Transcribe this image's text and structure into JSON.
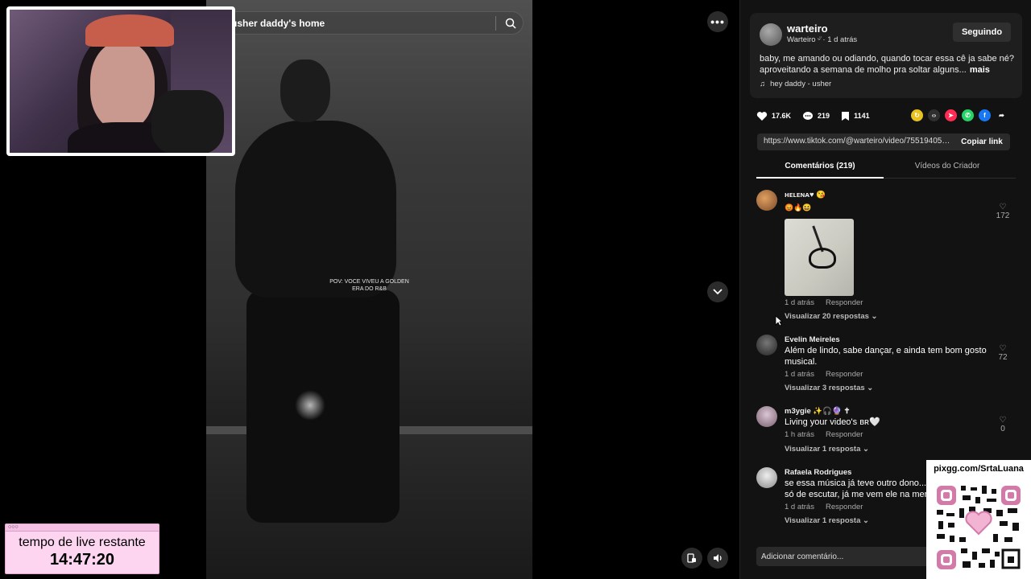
{
  "search": {
    "value": "usher daddy's home"
  },
  "video": {
    "caption_overlay": "POV: VOCE VIVEU A GOLDEN ERA DO R&B"
  },
  "timer": {
    "label": "tempo de live restante",
    "value": "14:47:20"
  },
  "qr": {
    "label": "pixgg.com/SrtaLuana"
  },
  "post": {
    "author_name": "warteiro",
    "author_sub": "Warteiro ᵕ̈ · 1 d atrás",
    "follow_label": "Seguindo",
    "description": "baby, me amando ou odiando, quando tocar essa cê ja sabe né? aproveitando a semana de molho pra soltar alguns...",
    "more_label": "mais",
    "music": "hey daddy - usher",
    "likes": "17.6K",
    "comments_count": "219",
    "saves": "1141",
    "link": "https://www.tiktok.com/@warteiro/video/755194051...",
    "copy_label": "Copiar link"
  },
  "tabs": {
    "comments": "Comentários (219)",
    "videos": "Vídeos do Criador"
  },
  "comments": [
    {
      "user": "ʜᴇʟᴇɴᴀ♥ 😘",
      "text": "😡🔥😆",
      "time": "1 d atrás",
      "reply": "Responder",
      "replies": "Visualizar 20 respostas",
      "likes": "172"
    },
    {
      "user": "Evelin Meireles",
      "text": "Além de lindo, sabe dançar, e ainda tem bom gosto musical.",
      "time": "1 d atrás",
      "reply": "Responder",
      "replies": "Visualizar 3 respostas",
      "likes": "72"
    },
    {
      "user": "m3ygie ✨🎧🔮 ✝",
      "text": "Living your video's ʙʀ🤍",
      "time": "1 h atrás",
      "reply": "Responder",
      "replies": "Visualizar 1 resposta",
      "likes": "0"
    },
    {
      "user": "Rafaela Rodrigues",
      "text": "se essa música já teve outro dono... só de escutar, já me vem ele na mer",
      "time": "1 d atrás",
      "reply": "Responder",
      "replies": "Visualizar 1 resposta",
      "likes": ""
    }
  ],
  "add_comment_placeholder": "Adicionar comentário...",
  "colors": {
    "panel_bg": "#121212",
    "timer_bg": "#fdd5f0",
    "accent_pink": "#fe2c55"
  }
}
